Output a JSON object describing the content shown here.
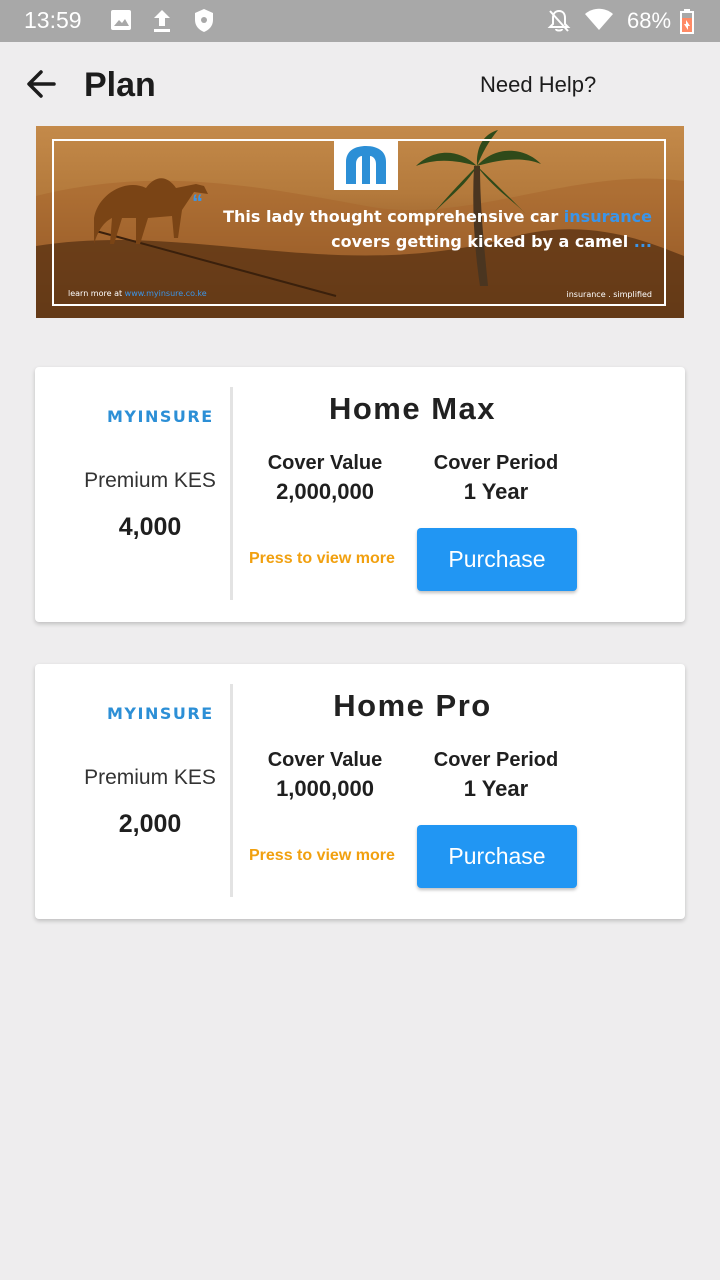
{
  "status_bar": {
    "time": "13:59",
    "battery_percent": "68%",
    "icons": [
      "image-icon",
      "upload-icon",
      "shield-icon",
      "notifications-off-icon",
      "wifi-icon",
      "battery-charging-icon"
    ]
  },
  "app_bar": {
    "title": "Plan",
    "help_label": "Need Help?"
  },
  "banner": {
    "quote_line_1_a": "This lady thought comprehensive car ",
    "quote_line_1_b": "insurance",
    "quote_line_2_a": "covers getting kicked by a camel ",
    "quote_line_2_b": "...",
    "footer_left_prefix": "learn more at ",
    "footer_left_link": "www.myinsure.co.ke",
    "footer_right": "insurance . simplified"
  },
  "plans": [
    {
      "brand": "MYINSURE",
      "premium_label": "Premium KES",
      "premium_value": "4,000",
      "name": "Home Max",
      "cover_value_label": "Cover Value",
      "cover_value": "2,000,000",
      "cover_period_label": "Cover Period",
      "cover_period": "1 Year",
      "view_more_label": "Press to view more",
      "purchase_label": "Purchase"
    },
    {
      "brand": "MYINSURE",
      "premium_label": "Premium KES",
      "premium_value": "2,000",
      "name": "Home Pro",
      "cover_value_label": "Cover Value",
      "cover_value": "1,000,000",
      "cover_period_label": "Cover Period",
      "cover_period": "1 Year",
      "view_more_label": "Press to view more",
      "purchase_label": "Purchase"
    }
  ],
  "colors": {
    "accent": "#2196f3",
    "view_more": "#f1a00f",
    "brand": "#2c8fd6",
    "status_bar": "#a8a8a8",
    "background": "#eeedee"
  }
}
